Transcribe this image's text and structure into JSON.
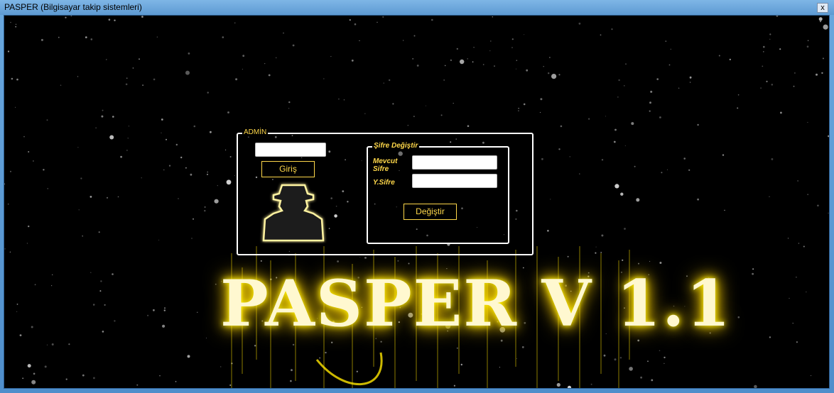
{
  "window": {
    "title": "PASPER  (Bilgisayar takip sistemleri)",
    "close_glyph": "x"
  },
  "admin": {
    "legend": "ADMİN",
    "password_value": "",
    "login_label": "Giriş",
    "avatar_icon": "spy-icon"
  },
  "change_password": {
    "legend": "Şifre Değiştir",
    "current_label_line1": "Mevcut",
    "current_label_line2": "Sifre",
    "current_value": "",
    "new_label": "Y.Sifre",
    "new_value": "",
    "submit_label": "Değiştir"
  },
  "logo": {
    "text": "PASPER V 1.1"
  },
  "colors": {
    "accent": "#ffd84a",
    "background": "#000000",
    "titlebar": "#6aa8de"
  }
}
